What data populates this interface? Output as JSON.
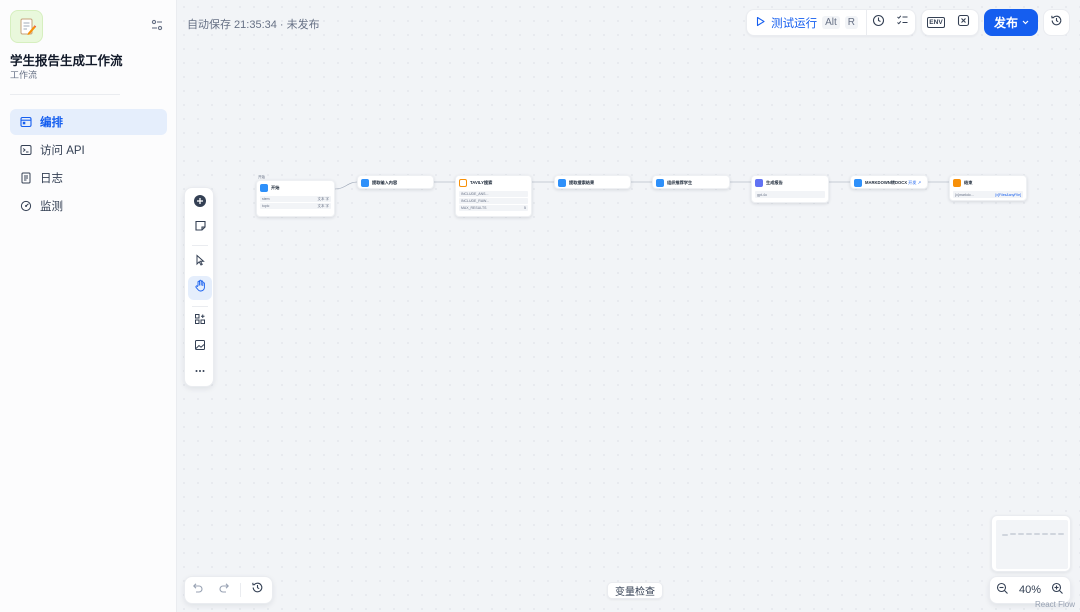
{
  "app": {
    "title": "学生报告生成工作流",
    "subtitle": "工作流",
    "icon": "memo-icon"
  },
  "nav": [
    {
      "label": "编排",
      "icon": "workflow-icon",
      "active": true
    },
    {
      "label": "访问 API",
      "icon": "terminal-icon",
      "active": false
    },
    {
      "label": "日志",
      "icon": "log-icon",
      "active": false
    },
    {
      "label": "监测",
      "icon": "monitor-icon",
      "active": false
    }
  ],
  "header": {
    "autosave": "自动保存 21:35:34 · 未发布",
    "run_label": "测试运行",
    "run_shortcut_1": "Alt",
    "run_shortcut_2": "R",
    "env_label": "ENV",
    "publish_label": "发布"
  },
  "nodes": {
    "start": {
      "group_label": "开始",
      "title": "开始",
      "vars": [
        {
          "name": "stem",
          "type": "文本 字"
        },
        {
          "name": "topic",
          "type": "文本 字"
        }
      ]
    },
    "n2": {
      "title": "提取输入内容"
    },
    "n3": {
      "title": "TAVILY搜索",
      "rows": [
        "INCLUDE_ANS...",
        "INCLUDE_RAW...",
        "MAX_RESULTS"
      ],
      "max_results": "5"
    },
    "n4": {
      "title": "提取搜索结果"
    },
    "n5": {
      "title": "组织推荐学生"
    },
    "n6": {
      "title": "生成报告",
      "model": "gpt-4o"
    },
    "n7": {
      "title": "MARKDOWN转DOCX",
      "badge": "开发 ↗"
    },
    "n8": {
      "title": "结束",
      "output_name": "{x}markdo...",
      "output_val": "[x]Files&anyFile]"
    }
  },
  "bottom": {
    "var_check": "变量检查",
    "zoom": "40%",
    "watermark": "React Flow"
  },
  "colors": {
    "accent": "#155eef",
    "start_icon": "#2e90fa",
    "llm_icon": "#6172f3",
    "end_icon": "#f79009",
    "code_icon": "#2e90fa"
  }
}
